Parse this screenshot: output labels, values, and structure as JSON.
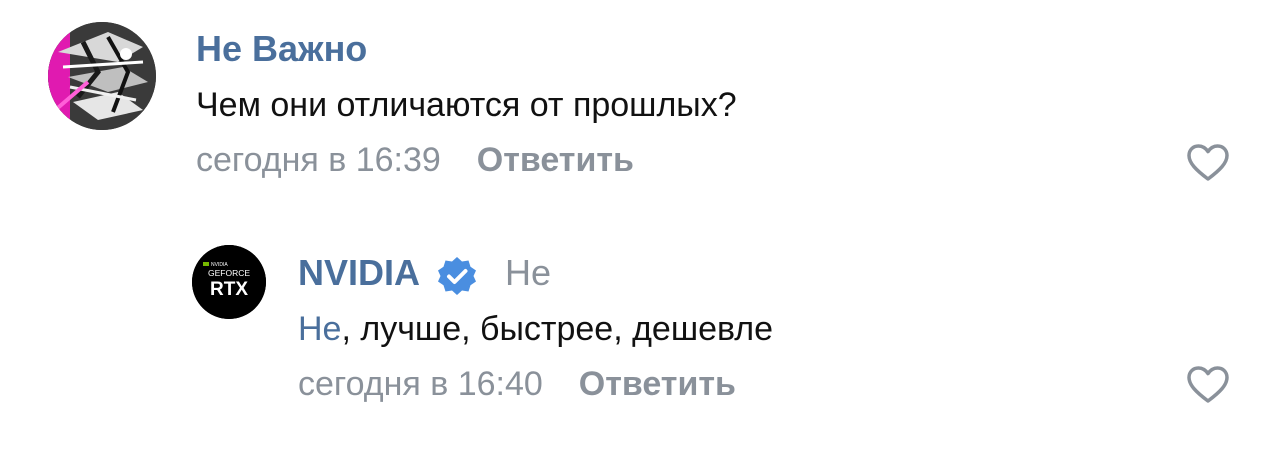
{
  "comments": [
    {
      "author": "Не Важно",
      "text": "Чем они отличаются от прошлых?",
      "time": "сегодня в 16:39",
      "reply_label": "Ответить",
      "avatar_icon": "abstract-art-avatar"
    },
    {
      "author": "NVIDIA",
      "verified": true,
      "reply_to": "Не",
      "mention": "Не",
      "text_rest": ", лучше, быстрее, дешевле",
      "time": "сегодня в 16:40",
      "reply_label": "Ответить",
      "avatar_icon": "geforce-rtx-logo",
      "avatar_logo": {
        "line1": "NVIDIA",
        "line2": "GEFORCE",
        "line3": "RTX"
      }
    }
  ],
  "colors": {
    "author": "#4a6f9c",
    "meta": "#8a919a",
    "verified_badge": "#4a8ee0",
    "avatar_accent": "#e01ab0"
  }
}
